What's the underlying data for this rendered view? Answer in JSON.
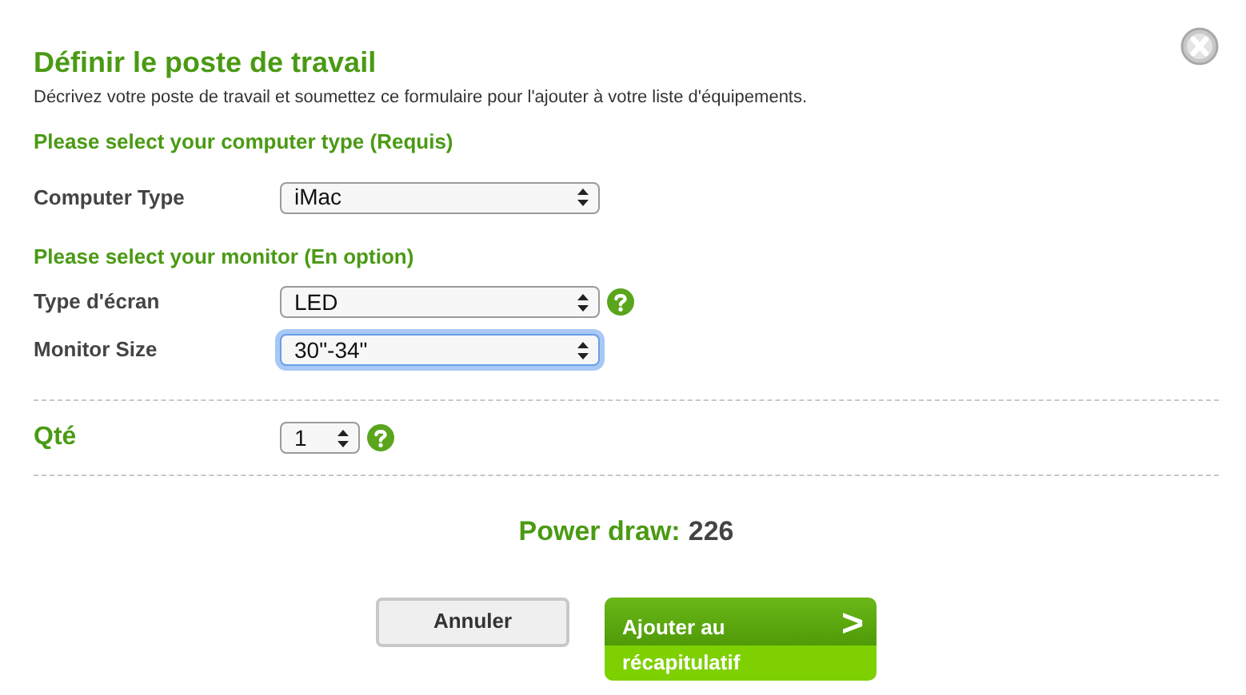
{
  "title": "Définir le poste de travail",
  "description": "Décrivez votre poste de travail et soumettez ce formulaire pour l'ajouter à votre liste d'équipements.",
  "sections": [
    {
      "heading": "Please select your computer type (Requis)",
      "fields": [
        {
          "label": "Computer Type",
          "value": "iMac",
          "help": false,
          "focused": false
        }
      ]
    },
    {
      "heading": "Please select your monitor (En option)",
      "fields": [
        {
          "label": "Type d'écran",
          "value": "LED",
          "help": true,
          "focused": false
        },
        {
          "label": "Monitor Size",
          "value": "30\"-34\"",
          "help": false,
          "focused": true
        }
      ]
    }
  ],
  "quantity": {
    "label": "Qté",
    "value": "1",
    "help": true
  },
  "power": {
    "label": "Power draw:",
    "value": "226"
  },
  "buttons": [
    {
      "kind": "secondary",
      "label": "Annuler"
    },
    {
      "kind": "primary",
      "label": "Ajouter au récapitulatif",
      "arrow": ">"
    }
  ]
}
